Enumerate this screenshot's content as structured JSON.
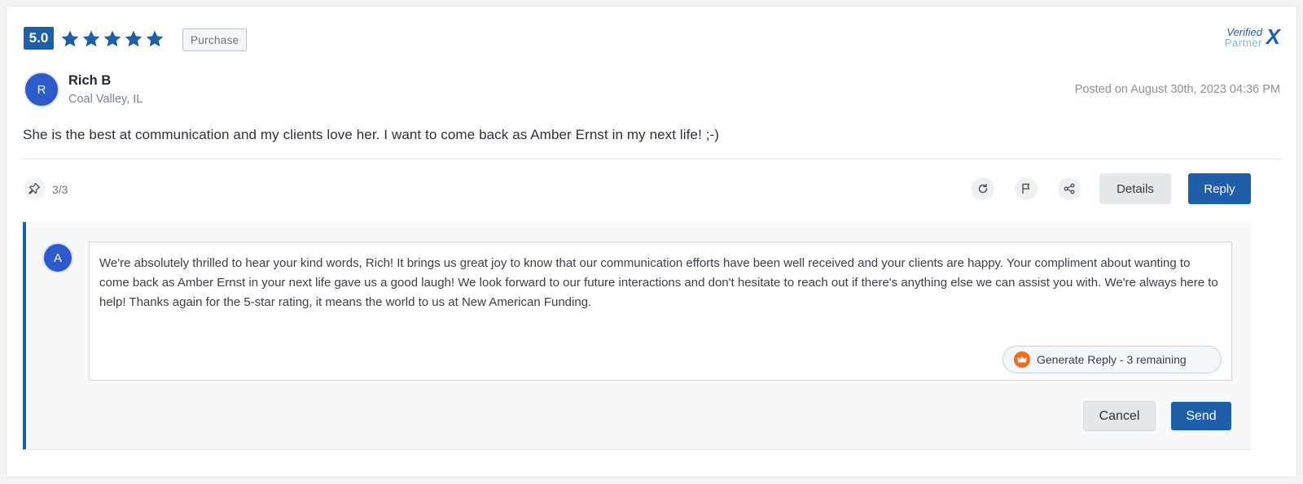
{
  "review": {
    "rating": "5.0",
    "stars": 5,
    "tag": "Purchase",
    "verified_line1": "Verified",
    "verified_line2": "Partner",
    "reviewer_initial": "R",
    "reviewer_name": "Rich B",
    "reviewer_location": "Coal Valley, IL",
    "posted": "Posted on August 30th, 2023 04:36 PM",
    "text": "She is the best at communication and my clients love her. I want to come back as Amber Ernst in my next life! ;-)"
  },
  "actions": {
    "pin_count": "3/3",
    "details_label": "Details",
    "reply_label": "Reply"
  },
  "reply_panel": {
    "author_initial": "A",
    "reply_text": "We're absolutely thrilled to hear your kind words, Rich! It brings us great joy to know that our communication efforts have been well received and your clients are happy. Your compliment about wanting to come back as Amber Ernst in your next life gave us a good laugh! We look forward to our future interactions and don't hesitate to reach out if there's anything else we can assist you with. We're always here to help! Thanks again for the 5-star rating, it means the world to us at New American Funding.",
    "generate_label": "Generate Reply - 3 remaining",
    "cancel_label": "Cancel",
    "send_label": "Send"
  },
  "colors": {
    "accent": "#1f5ea8",
    "avatar": "#2c5ac8",
    "crown": "#f26b1d"
  },
  "icons": [
    "star-icon",
    "verified-partner-logo",
    "pin-icon",
    "refresh-icon",
    "flag-icon",
    "share-icon",
    "crown-icon"
  ]
}
